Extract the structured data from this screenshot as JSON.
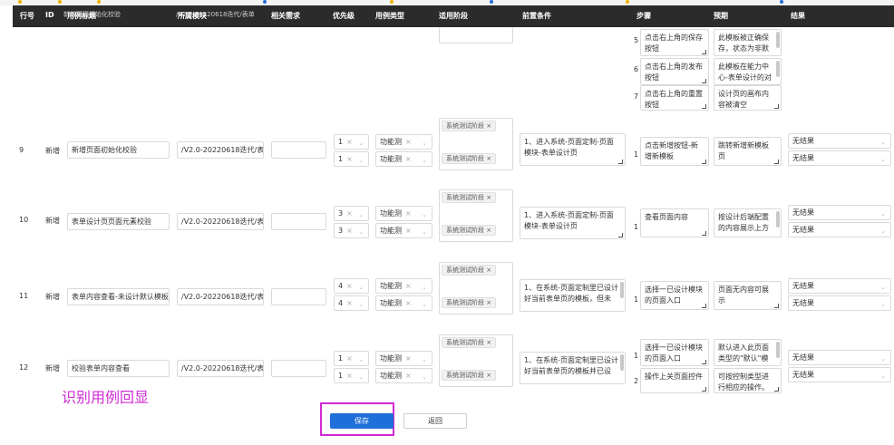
{
  "header": {
    "columns": [
      "行号",
      "ID",
      "用例标题",
      "所属模块",
      "相关需求",
      "优先级",
      "用例类型",
      "适用阶段",
      "前置条件",
      "步骤",
      "预期",
      "结果"
    ],
    "bleed_title": "新增页面初始化校验",
    "bleed_module": "/V2.0-20220618迭代/表单"
  },
  "carryover": {
    "stage_tag": "系统测试阶段",
    "steps": [
      {
        "no": "5",
        "step": "点击右上角的保存按钮",
        "expected": "此模板被正确保存，状态为非默认"
      },
      {
        "no": "6",
        "step": "点击右上角的发布按钮",
        "expected": "此模板在能力中心-表单设计的对"
      },
      {
        "no": "7",
        "step": "点击右上角的重置按钮",
        "expected": "设计页的画布内容被清空"
      }
    ],
    "top_step_text": "的组件，在其右",
    "top_expected_text": "设置的属性展示"
  },
  "rows": [
    {
      "row_no": "9",
      "id": "新增",
      "title": "新增页面初始化校验",
      "module": "/V2.0-20220618迭代/表单",
      "priority": [
        "1",
        "1"
      ],
      "types": [
        "功能测",
        "功能测"
      ],
      "stages": [
        "系统测试阶段",
        "系统测试阶段"
      ],
      "precondition": "1、进入系统-页面定制-页面模块-表单设计页",
      "steps": [
        {
          "no": "1",
          "step": "点击新增按钮-新增新模板",
          "expected": "跳转新增新模板页"
        }
      ],
      "results": [
        "无结果",
        "无结果"
      ]
    },
    {
      "row_no": "10",
      "id": "新增",
      "title": "表单设计页页面元素校验",
      "module": "/V2.0-20220618迭代/表单",
      "priority": [
        "3",
        "3"
      ],
      "types": [
        "功能测",
        "功能测"
      ],
      "stages": [
        "系统测试阶段",
        "系统测试阶段"
      ],
      "precondition": "1、进入系统-页面定制-页面模块-表单设计页",
      "steps": [
        {
          "no": "1",
          "step": "查看页面内容",
          "expected": "按设计后端配置的内容展示上方"
        }
      ],
      "results": [
        "无结果",
        "无结果"
      ]
    },
    {
      "row_no": "11",
      "id": "新增",
      "title": "表单内容查看-未设计默认模板时",
      "module": "/V2.0-20220618迭代/表单",
      "priority": [
        "4",
        "4"
      ],
      "types": [
        "功能测",
        "功能测"
      ],
      "stages": [
        "系统测试阶段",
        "系统测试阶段"
      ],
      "precondition": "1、在系统-页面定制里已设计好当前表单页的模板，但未",
      "steps": [
        {
          "no": "1",
          "step": "选择一已设计模块的页面入口",
          "expected": "页面无内容可展示"
        }
      ],
      "results": [
        "无结果",
        "无结果"
      ]
    },
    {
      "row_no": "12",
      "id": "新增",
      "title": "校验表单内容查看",
      "module": "/V2.0-20220618迭代/表单",
      "priority": [
        "1",
        "1"
      ],
      "types": [
        "功能测",
        "功能测"
      ],
      "stages": [
        "系统测试阶段",
        "系统测试阶段"
      ],
      "precondition": "1、在系统-页面定制里已设计好当前表单页的模板并已设",
      "steps": [
        {
          "no": "1",
          "step": "选择一已设计模块的页面入口",
          "expected": "默认进入此页面类型的\"默认\"模块"
        },
        {
          "no": "2",
          "step": "操作上关页面控件",
          "expected": "可按控制类型进行相应的操作。"
        }
      ],
      "results": [
        "无结果",
        "无结果"
      ]
    }
  ],
  "annotation": "识别用例回显",
  "actions": {
    "save": "保存",
    "back": "返回"
  },
  "icons": {
    "clear": "×",
    "caret": "⌄"
  },
  "colors": {
    "primary": "#1e6fd9",
    "highlight": "#d12ad6",
    "header_bg": "#2b2b2b"
  }
}
